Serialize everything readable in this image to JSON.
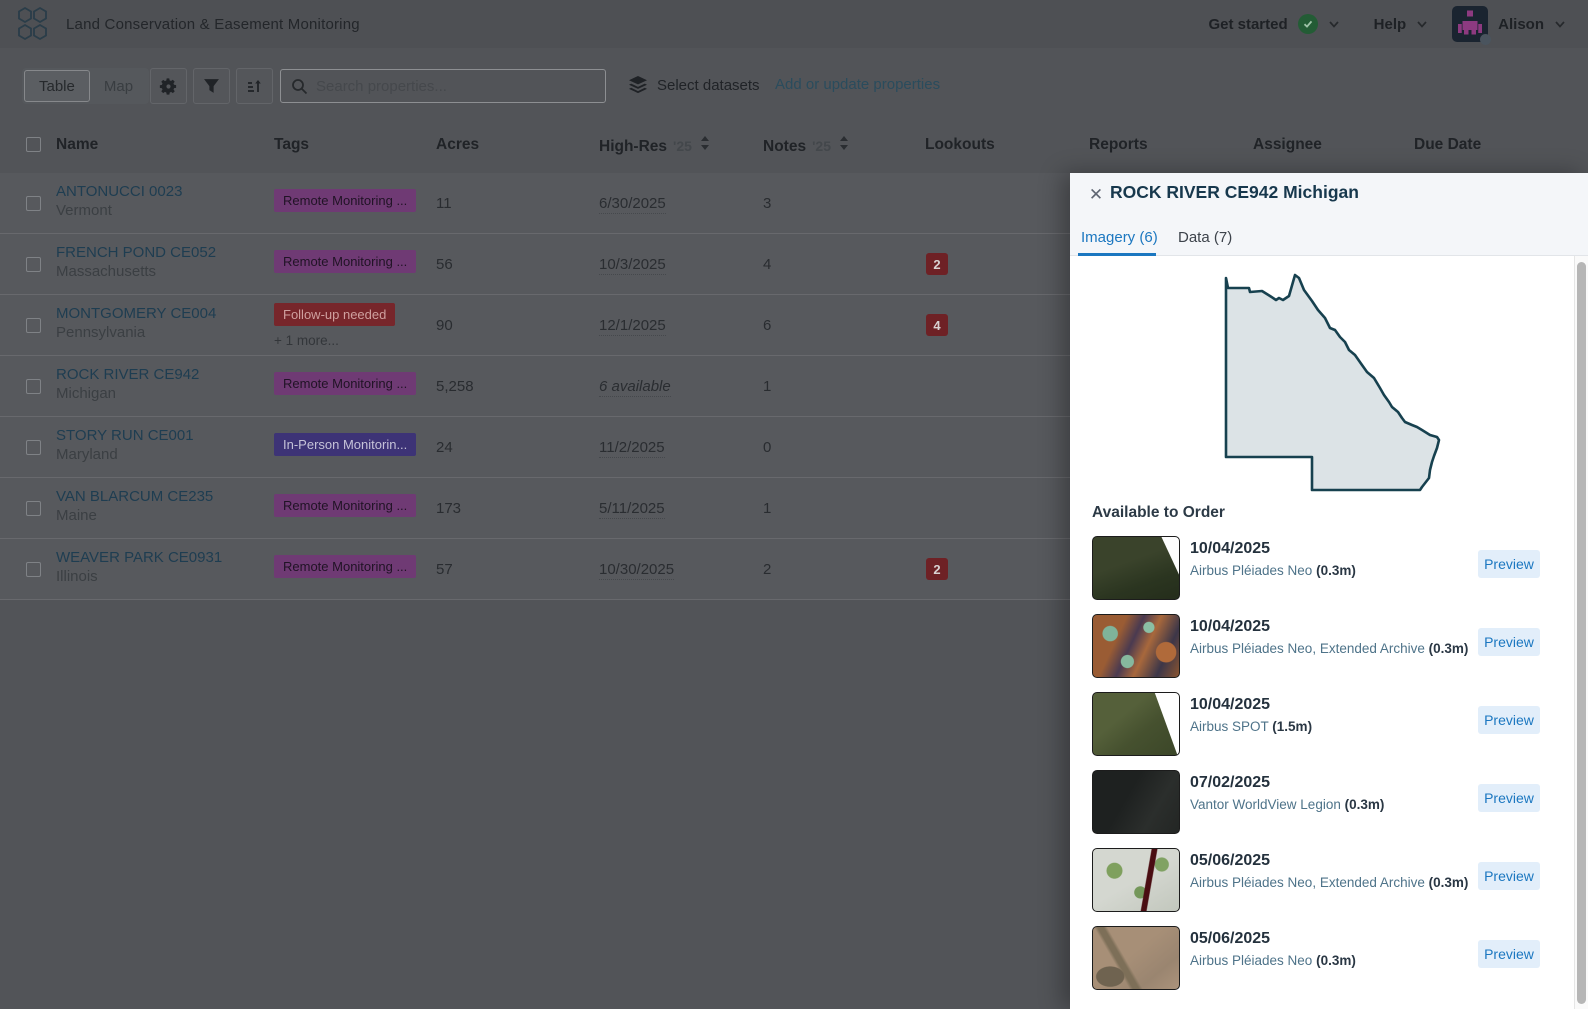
{
  "header": {
    "app_title": "Land Conservation & Easement Monitoring",
    "get_started_label": "Get started",
    "help_label": "Help",
    "user_name": "Alison"
  },
  "toolbar": {
    "view_table_label": "Table",
    "view_map_label": "Map",
    "search_placeholder": "Search properties...",
    "select_datasets_label": "Select datasets",
    "add_update_label": "Add or update properties"
  },
  "table": {
    "columns": {
      "name": "Name",
      "tags": "Tags",
      "acres": "Acres",
      "highres": "High-Res",
      "highres_year": "'25",
      "notes": "Notes",
      "notes_year": "'25",
      "lookouts": "Lookouts",
      "reports": "Reports",
      "assignee": "Assignee",
      "due_date": "Due Date"
    },
    "rows": [
      {
        "name": "ANTONUCCI 0023",
        "state": "Vermont",
        "tag": "Remote Monitoring ...",
        "acres": "11",
        "highres": "6/30/2025",
        "notes": "3",
        "lookouts": ""
      },
      {
        "name": "FRENCH POND CE052",
        "state": "Massachusetts",
        "tag": "Remote Monitoring ...",
        "acres": "56",
        "highres": "10/3/2025",
        "notes": "4",
        "lookouts": "2"
      },
      {
        "name": "MONTGOMERY CE004",
        "state": "Pennsylvania",
        "tag": "Follow-up needed",
        "more_tags": "+ 1 more...",
        "acres": "90",
        "highres": "12/1/2025",
        "notes": "6",
        "lookouts": "4"
      },
      {
        "name": "ROCK RIVER CE942",
        "state": "Michigan",
        "tag": "Remote Monitoring ...",
        "acres": "5,258",
        "highres": "6 available",
        "notes": "1",
        "lookouts": ""
      },
      {
        "name": "STORY RUN CE001",
        "state": "Maryland",
        "tag": "In-Person Monitorin...",
        "acres": "24",
        "highres": "11/2/2025",
        "notes": "0",
        "lookouts": ""
      },
      {
        "name": "VAN BLARCUM CE235",
        "state": "Maine",
        "tag": "Remote Monitoring ...",
        "acres": "173",
        "highres": "5/11/2025",
        "notes": "1",
        "lookouts": ""
      },
      {
        "name": "WEAVER PARK CE0931",
        "state": "Illinois",
        "tag": "Remote Monitoring ...",
        "acres": "57",
        "highres": "10/30/2025",
        "notes": "2",
        "lookouts": "2"
      }
    ]
  },
  "panel": {
    "title": "ROCK RIVER CE942 Michigan",
    "close_label": "✕",
    "tabs": {
      "imagery": "Imagery (6)",
      "data": "Data (7)"
    },
    "section_heading": "Available to Order",
    "preview_label": "Preview",
    "accent_color": "#1b77c0",
    "items": [
      {
        "date": "10/04/2025",
        "source": "Airbus Pléiades Neo",
        "resolution": "(0.3m)"
      },
      {
        "date": "10/04/2025",
        "source": "Airbus Pléiades Neo, Extended Archive",
        "resolution": "(0.3m)"
      },
      {
        "date": "10/04/2025",
        "source": "Airbus SPOT",
        "resolution": "(1.5m)"
      },
      {
        "date": "07/02/2025",
        "source": "Vantor WorldView Legion",
        "resolution": "(0.3m)"
      },
      {
        "date": "05/06/2025",
        "source": "Airbus Pléiades Neo, Extended Archive",
        "resolution": "(0.3m)"
      },
      {
        "date": "05/06/2025",
        "source": "Airbus Pléiades Neo",
        "resolution": "(0.3m)"
      }
    ]
  }
}
